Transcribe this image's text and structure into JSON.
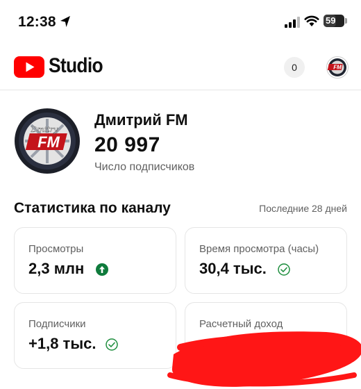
{
  "status_bar": {
    "time": "12:38",
    "battery": "59"
  },
  "header": {
    "logo_text": "Studio",
    "notification_count": "0"
  },
  "channel": {
    "name": "Дмитрий FM",
    "subscribers": "20 997",
    "subscribers_label": "Число подписчиков",
    "avatar_text": "FM",
    "avatar_script": "Dmitry"
  },
  "stats": {
    "title": "Статистика по каналу",
    "period": "Последние 28 дней",
    "cards": [
      {
        "label": "Просмотры",
        "value": "2,3 млн",
        "icon": "arrow-up-circle-icon"
      },
      {
        "label": "Время просмотра (часы)",
        "value": "30,4 тыс.",
        "icon": "check-circle-icon"
      },
      {
        "label": "Подписчики",
        "value": "+1,8 тыс.",
        "icon": "check-circle-icon"
      },
      {
        "label": "Расчетный доход",
        "value": "",
        "icon": "redacted"
      }
    ]
  },
  "colors": {
    "brand_red": "#ff0000",
    "positive_green": "#0f7b3c",
    "check_green": "#1e8e3e",
    "redaction": "#ff1616"
  }
}
